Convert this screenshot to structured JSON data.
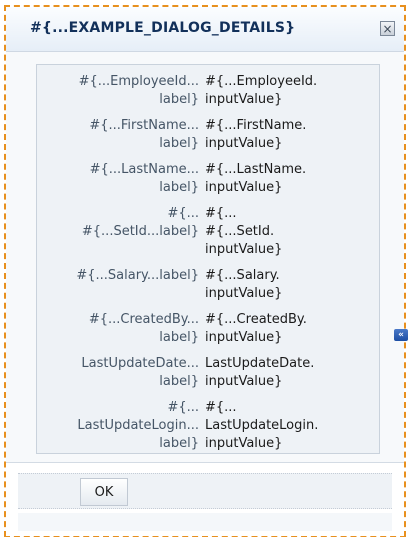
{
  "dialog": {
    "title": "#{...EXAMPLE_DIALOG_DETAILS}",
    "close_symbol": "×"
  },
  "fields": [
    {
      "label": "#{...EmployeeId...\nlabel}",
      "value": "#{...EmployeeId.\ninputValue}"
    },
    {
      "label": "#{...FirstName...\nlabel}",
      "value": "#{...FirstName.\ninputValue}"
    },
    {
      "label": "#{...LastName...\nlabel}",
      "value": "#{...LastName.\ninputValue}"
    },
    {
      "label": "#{...\n#{...SetId...label}",
      "value": "#{...\n#{...SetId.\ninputValue}"
    },
    {
      "label": "#{...Salary...label}",
      "value": "#{...Salary.\ninputValue}"
    },
    {
      "label": "#{...CreatedBy...\nlabel}",
      "value": "#{...CreatedBy.\ninputValue}"
    },
    {
      "label": "LastUpdateDate...\nlabel}",
      "value": "LastUpdateDate.\ninputValue}"
    },
    {
      "label": "#{...\nLastUpdateLogin...\nlabel}",
      "value": "#{...\nLastUpdateLogin.\ninputValue}"
    }
  ],
  "side_toggle_symbol": "«",
  "footer": {
    "ok_label": "OK"
  },
  "colors": {
    "focus_border": "#e8901e",
    "title_text": "#12305a",
    "panel_bg": "#eef2f6"
  },
  "icons": {
    "close": "close-icon",
    "collapse": "double-chevron-left-icon"
  }
}
